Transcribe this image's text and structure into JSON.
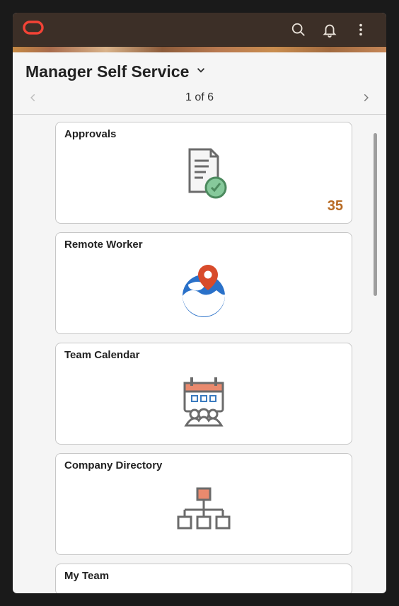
{
  "header": {
    "brand": "oracle"
  },
  "page_title": "Manager Self Service",
  "pager": {
    "label": "1 of 6"
  },
  "tiles": [
    {
      "title": "Approvals",
      "badge": "35",
      "icon": "document-check-icon"
    },
    {
      "title": "Remote Worker",
      "icon": "globe-pin-icon"
    },
    {
      "title": "Team Calendar",
      "icon": "calendar-people-icon"
    },
    {
      "title": "Company Directory",
      "icon": "org-chart-icon"
    },
    {
      "title": "My Team",
      "icon": "team-icon"
    }
  ]
}
